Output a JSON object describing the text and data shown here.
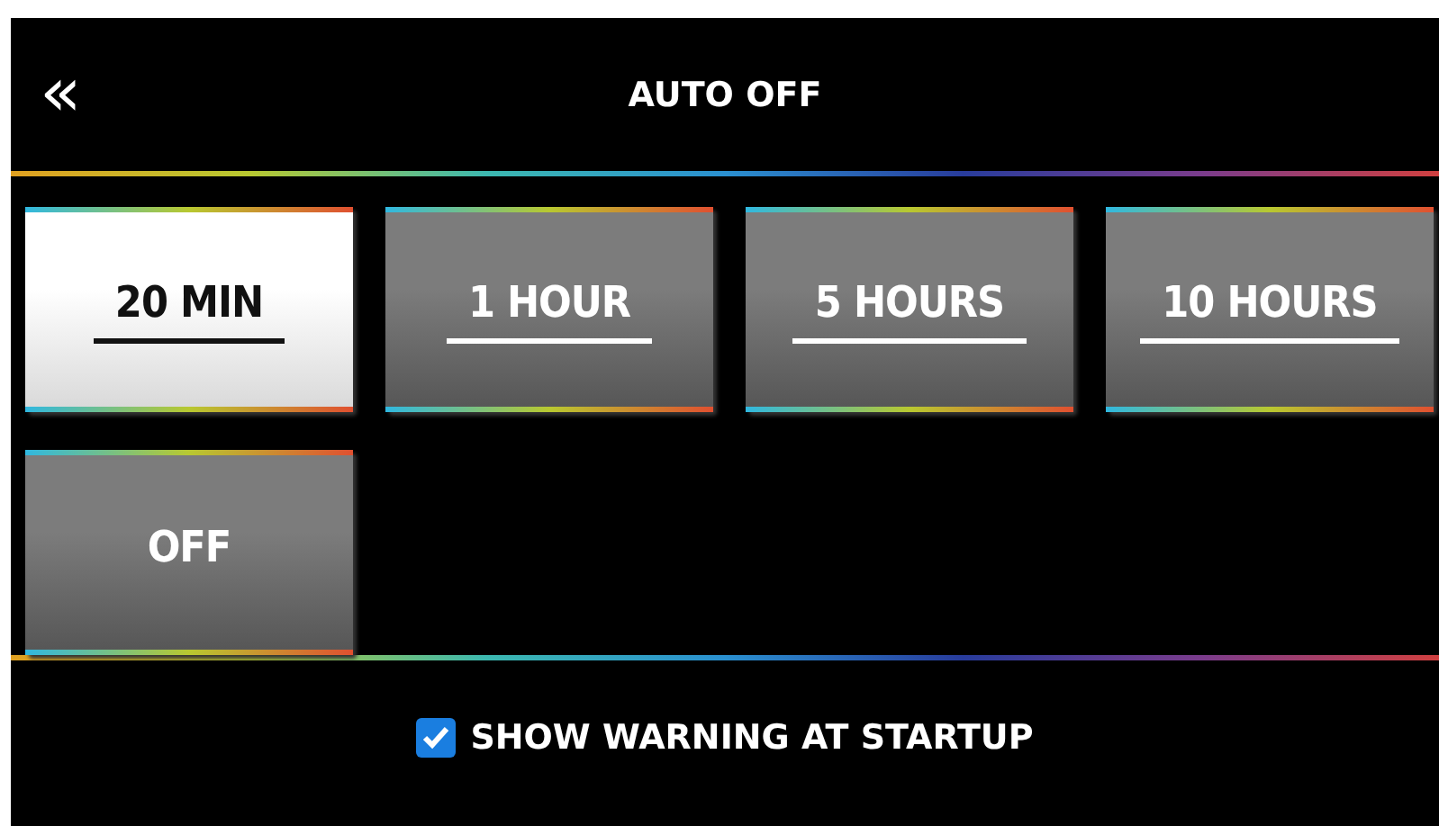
{
  "header": {
    "back": "«",
    "title": "AUTO OFF"
  },
  "options": [
    {
      "label": "20 MIN",
      "selected": true,
      "underlined": true
    },
    {
      "label": "1 HOUR",
      "selected": false,
      "underlined": true
    },
    {
      "label": "5 HOURS",
      "selected": false,
      "underlined": true
    },
    {
      "label": "10 HOURS",
      "selected": false,
      "underlined": true
    },
    {
      "label": "OFF",
      "selected": false,
      "underlined": false
    }
  ],
  "warning": {
    "label": "SHOW WARNING AT STARTUP",
    "checked": true
  }
}
